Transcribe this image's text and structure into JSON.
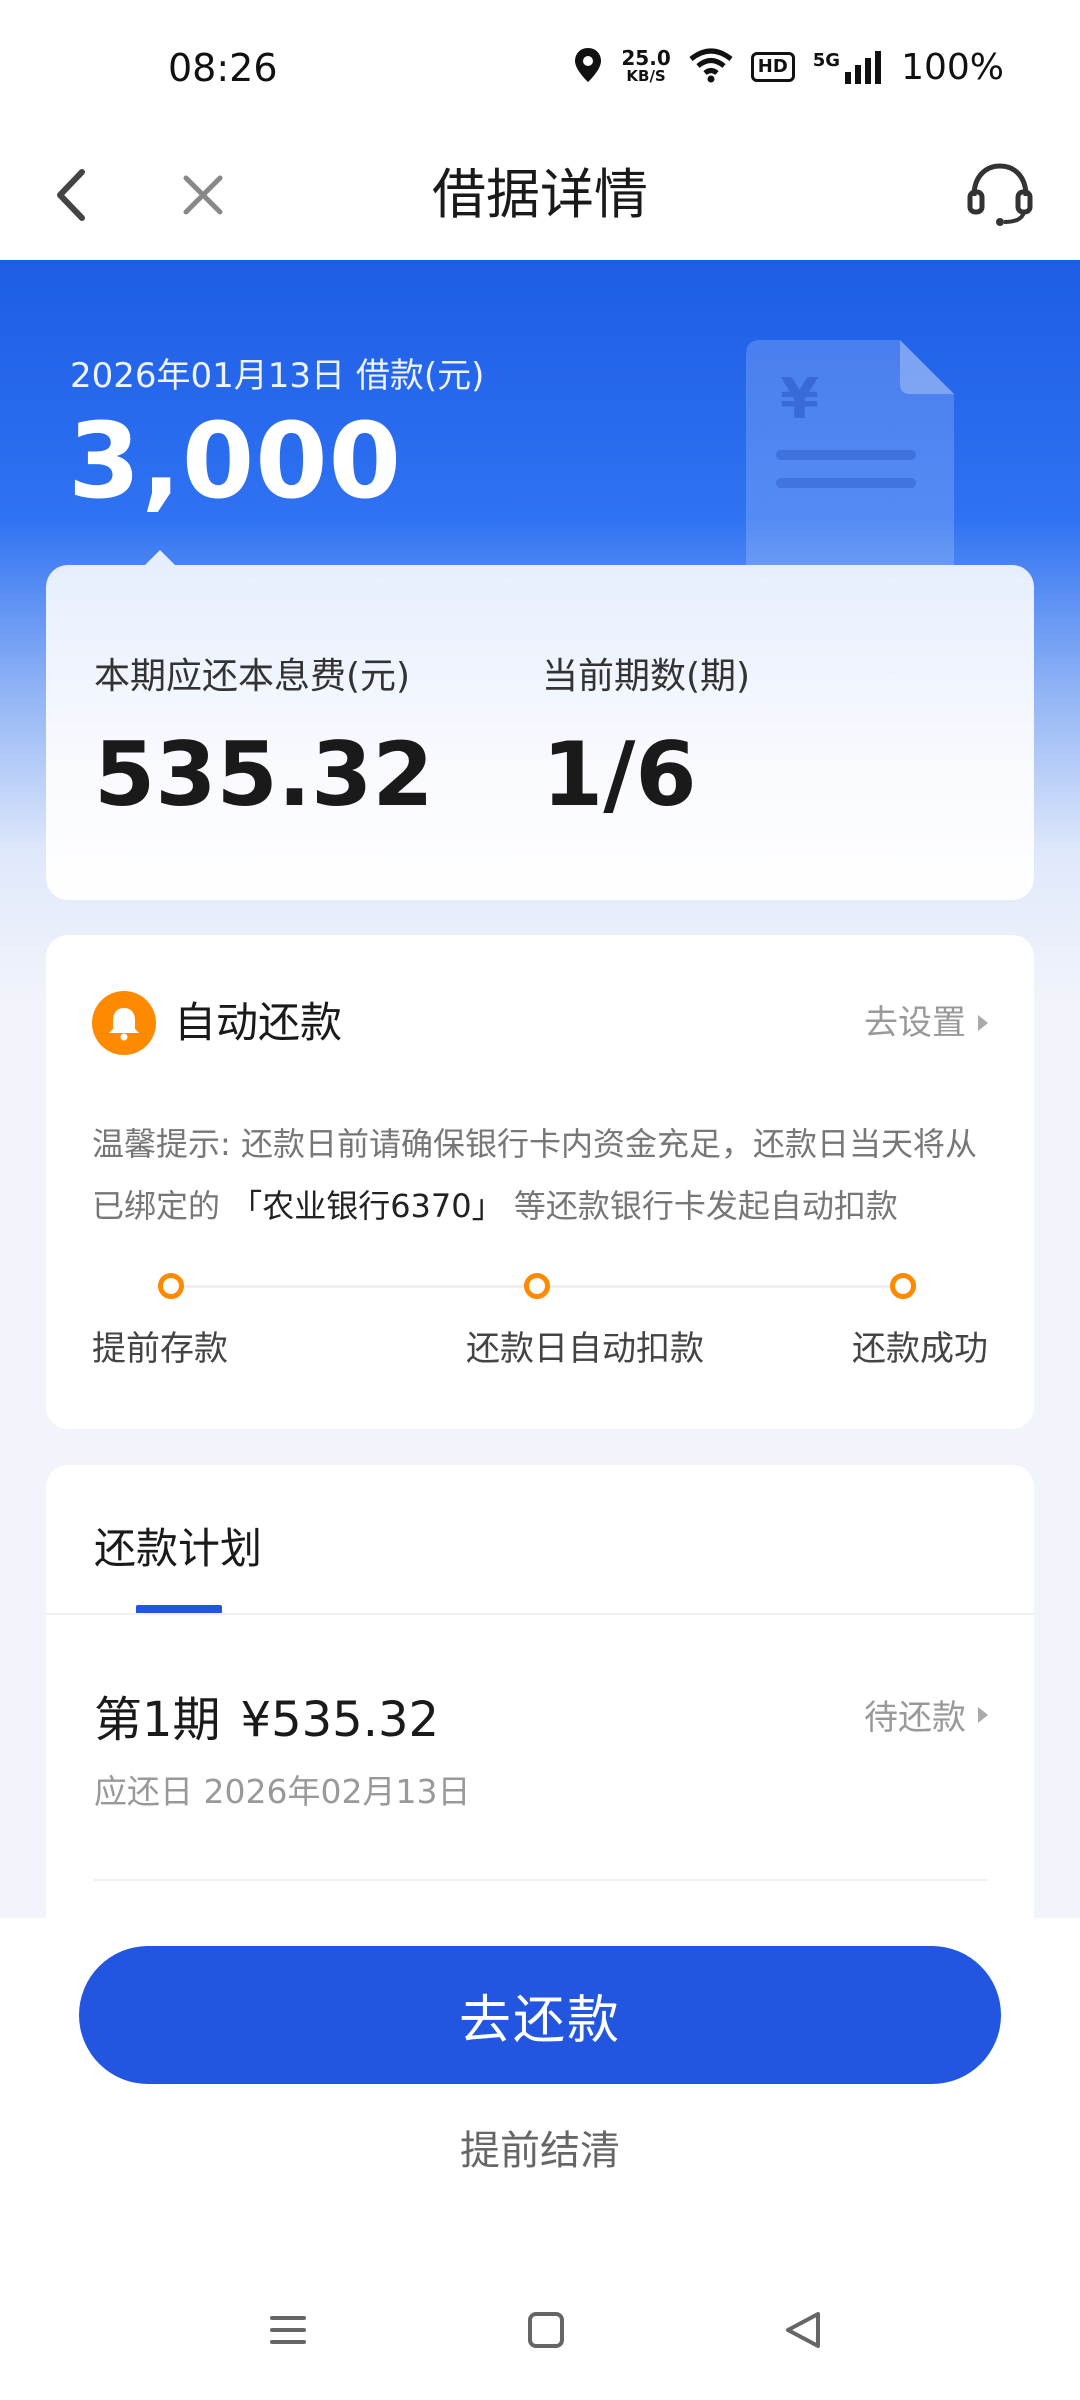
{
  "status_bar": {
    "time": "08:26",
    "net_speed_value": "25.0",
    "net_speed_unit": "KB/S",
    "hd_label": "HD",
    "signal_label": "5G",
    "battery": "100%"
  },
  "nav": {
    "title": "借据详情",
    "back_icon": "chevron-left-icon",
    "close_icon": "close-icon",
    "service_icon": "headset-icon"
  },
  "hero": {
    "label": "2026年01月13日 借款(元)",
    "amount": "3,000",
    "decor_icon": "yuan-document-icon"
  },
  "summary": {
    "due_label": "本期应还本息费(元)",
    "due_value": "535.32",
    "period_label": "当前期数(期)",
    "period_value": "1/6"
  },
  "auto_repay": {
    "icon": "bell-icon",
    "title": "自动还款",
    "setting_link": "去设置",
    "tip_prefix": "温馨提示: 还款日前请确保银行卡内资金充足，还款日当天将从已绑定的 ",
    "tip_bank": "「农业银行6370」",
    "tip_suffix": " 等还款银行卡发起自动扣款",
    "steps": [
      "提前存款",
      "还款日自动扣款",
      "还款成功"
    ]
  },
  "plan": {
    "tab_label": "还款计划",
    "rows": [
      {
        "period": "第1期",
        "amount": "¥535.32",
        "due_date": "应还日 2026年02月13日",
        "status": "待还款"
      }
    ]
  },
  "actions": {
    "repay_button": "去还款",
    "settle_link": "提前结清"
  },
  "colors": {
    "primary": "#2255e0",
    "accent_orange": "#ff8a00",
    "hero_blue": "#1d5de6"
  }
}
